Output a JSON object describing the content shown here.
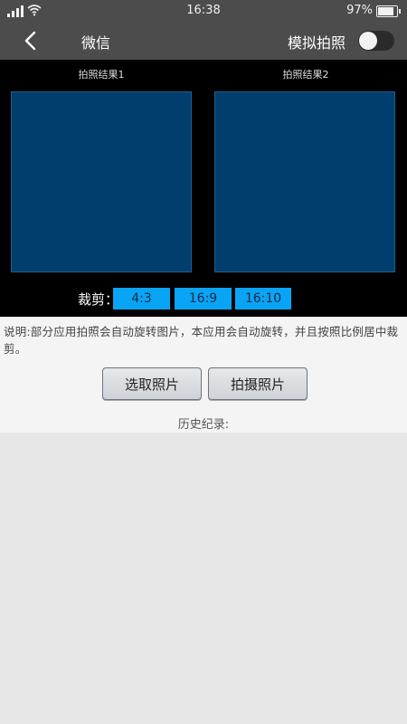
{
  "status_bar": {
    "time": "16:38",
    "battery": "97%",
    "battery_level": 0.97
  },
  "header": {
    "title": "微信",
    "mode_label": "模拟拍照",
    "mode_toggle_on": false
  },
  "results": [
    {
      "label": "拍照结果1"
    },
    {
      "label": "拍照结果2"
    }
  ],
  "crop": {
    "label": "裁剪：",
    "options": [
      "4:3",
      "16:9",
      "16:10"
    ]
  },
  "description": "说明:部分应用拍照会自动旋转图片，本应用会自动旋转，并且按照比例居中裁剪。",
  "actions": {
    "select_photo": "选取照片",
    "take_photo": "拍摄照片"
  },
  "history": {
    "label": "历史纪录:",
    "items": []
  },
  "colors": {
    "header_bg": "#4c4c4c",
    "photo_bg": "#003e6e",
    "crop_button": "#0aa4f5"
  }
}
